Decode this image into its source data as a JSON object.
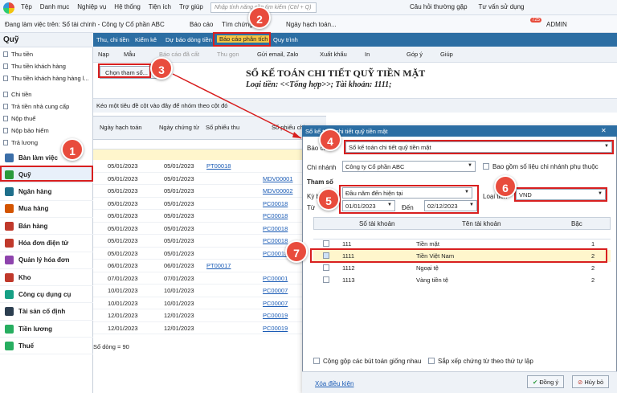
{
  "menu": [
    "Tệp",
    "Danh mục",
    "Nghiệp vụ",
    "Hệ thống",
    "Tiện ích",
    "Trợ giúp"
  ],
  "search_placeholder": "Nhập tính năng cần tìm kiếm (Ctrl + Q)",
  "topright": {
    "faq": "Câu hỏi thường gặp",
    "help": "Tư vấn sử dụng",
    "notif": "725",
    "user": "ADMIN"
  },
  "secbar": {
    "working": "Đang làm việc trên: Sổ tài chính - Công ty Cổ phần ABC",
    "report": "Báo cáo",
    "find": "Tìm chứng từ",
    "date": "Ngày hạch toán..."
  },
  "sidebar": {
    "title": "Quỹ",
    "items": [
      "Thu tiền",
      "Thu tiền khách hàng",
      "Thu tiền khách hàng hàng l...",
      "Chi tiền",
      "Trả tiền nhà cung cấp",
      "Nộp thuế",
      "Nộp bảo hiểm",
      "Trả lương"
    ],
    "modules": [
      "Bàn làm việc",
      "Quỹ",
      "Ngân hàng",
      "Mua hàng",
      "Bán hàng",
      "Hóa đơn điện tử",
      "Quản lý hóa đơn",
      "Kho",
      "Công cụ dụng cụ",
      "Tài sản cố định",
      "Tiền lương",
      "Thuế"
    ]
  },
  "tabs": [
    "Thu, chi tiền",
    "Kiểm kê",
    "Dự báo dòng tiền",
    "Báo cáo phân tích",
    "Quy trình"
  ],
  "toolbar": [
    "Nạp",
    "Mẫu",
    "Báo cáo đã cất",
    "Thu gọn",
    "Gửi email, Zalo",
    "Xuất khẩu",
    "In",
    "Góp ý",
    "Giúp"
  ],
  "choose_param": "Chọn tham số...",
  "report": {
    "title": "SỔ KẾ TOÁN CHI TIẾT QUỸ TIỀN MẶT",
    "subtitle": "Loại tiền: <<Tổng hợp>>; Tài khoản: 1111;",
    "group_hint": "Kéo một tiêu đề cột vào đây để nhóm theo cột đó"
  },
  "grid": {
    "headers": [
      "Ngày hạch toán",
      "Ngày chứng từ",
      "Số phiếu thu",
      "Số phiếu chi"
    ],
    "rows": [
      [
        "05/01/2023",
        "05/01/2023",
        "PT00018",
        ""
      ],
      [
        "05/01/2023",
        "05/01/2023",
        "",
        "MDV00001"
      ],
      [
        "05/01/2023",
        "05/01/2023",
        "",
        "MDV00002"
      ],
      [
        "05/01/2023",
        "05/01/2023",
        "",
        "PC00018"
      ],
      [
        "05/01/2023",
        "05/01/2023",
        "",
        "PC00018"
      ],
      [
        "05/01/2023",
        "05/01/2023",
        "",
        "PC00018"
      ],
      [
        "05/01/2023",
        "05/01/2023",
        "",
        "PC00018"
      ],
      [
        "05/01/2023",
        "05/01/2023",
        "",
        "PC00018"
      ],
      [
        "06/01/2023",
        "06/01/2023",
        "PT00017",
        ""
      ],
      [
        "07/01/2023",
        "07/01/2023",
        "",
        "PC00001"
      ],
      [
        "10/01/2023",
        "10/01/2023",
        "",
        "PC00007"
      ],
      [
        "10/01/2023",
        "10/01/2023",
        "",
        "PC00007"
      ],
      [
        "12/01/2023",
        "12/01/2023",
        "",
        "PC00019"
      ],
      [
        "12/01/2023",
        "12/01/2023",
        "",
        "PC00019"
      ]
    ],
    "count": "Số dòng = 90"
  },
  "dialog": {
    "title": "Sổ kế toán chi tiết quỹ tiền mặt",
    "report_label": "Báo cáo",
    "report_value": "Sổ kế toán chi tiết quỹ tiền mặt",
    "branch_label": "Chi nhánh",
    "branch_value": "Công ty Cổ phần ABC",
    "include_sub": "Bao gồm số liệu chi nhánh phụ thuộc",
    "param_title": "Tham số",
    "period_label": "Kỳ báo cáo",
    "period_value": "Đầu năm đến hiện tại",
    "from_label": "Từ",
    "from_value": "01/01/2023",
    "to_label": "Đến",
    "to_value": "02/12/2023",
    "currency_label": "Loại tiền",
    "currency_value": "VND",
    "acc_headers": [
      "Số tài khoản",
      "Tên tài khoản",
      "Bậc"
    ],
    "accounts": [
      [
        "111",
        "Tiền mặt",
        "1"
      ],
      [
        "1111",
        "Tiền Việt Nam",
        "2"
      ],
      [
        "1112",
        "Ngoại tệ",
        "2"
      ],
      [
        "1113",
        "Vàng tiền tệ",
        "2"
      ]
    ],
    "merge": "Cộng gộp các bút toán giống nhau",
    "sort": "Sắp xếp chứng từ theo thứ tự lập",
    "clear": "Xóa điều kiện",
    "ok": "Đồng ý",
    "cancel": "Hủy bỏ"
  },
  "badges": [
    "1",
    "2",
    "3",
    "4",
    "5",
    "6",
    "7"
  ]
}
